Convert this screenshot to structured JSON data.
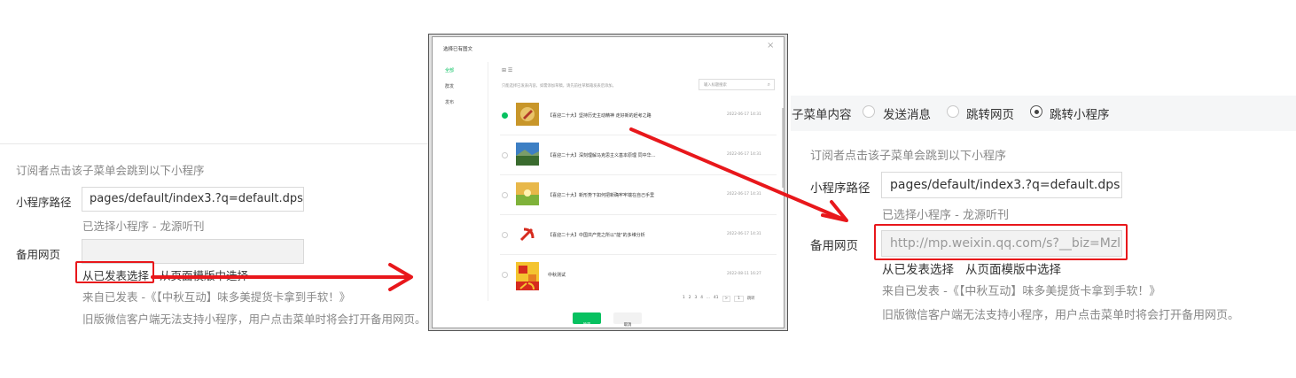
{
  "left_panel": {
    "description": "订阅者点击该子菜单会跳到以下小程序",
    "path_label": "小程序路径",
    "path_value": "pages/default/index3.?q=default.dps.q",
    "selected_miniprogram": "已选择小程序 - 龙源听刊",
    "backup_label": "备用网页",
    "backup_value": "",
    "link_published": "从已发表选择",
    "link_template": "从页面模版中选择",
    "source_text": "来自已发表 -《【中秋互动】味多美提货卡拿到手软！》",
    "note": "旧版微信客户端无法支持小程序，用户点击菜单时将会打开备用网页。"
  },
  "modal": {
    "title": "选择已有图文",
    "close_icon": "close-icon",
    "side_tabs": [
      "全部",
      "群发",
      "发布"
    ],
    "view_icons": "grid-list-icons",
    "hint": "只能选择已发表内容，如需添加草稿，请先前往草稿箱发表后添加。",
    "search_placeholder": "输入标题搜索",
    "items": [
      {
        "title": "【喜迎二十大】坚持历史主动精神 走好新的赶考之路",
        "date": "2022-06-17 14:31",
        "selected": true
      },
      {
        "title": "【喜迎二十大】深刻理解马克思主义基本原理 同中华…",
        "date": "2022-06-17 14:31",
        "selected": false
      },
      {
        "title": "【喜迎二十大】新形势下如何把新确牢牢端在自己手里",
        "date": "2022-06-17 14:31",
        "selected": false
      },
      {
        "title": "【喜迎二十大】中国共产党之所以\"能\"的多维分析",
        "date": "2022-06-17 14:31",
        "selected": false
      },
      {
        "title": "中秋测试",
        "date": "2022-08-11 16:27",
        "selected": false
      }
    ],
    "pagination": [
      "1",
      "2",
      "3",
      "4",
      "...",
      "41",
      ">",
      "1",
      "跳转"
    ],
    "confirm_label": "确定",
    "cancel_label": "取消"
  },
  "right_panel": {
    "menu_content_label": "子菜单内容",
    "options": [
      "发送消息",
      "跳转网页",
      "跳转小程序"
    ],
    "selected_option": "跳转小程序",
    "description": "订阅者点击该子菜单会跳到以下小程序",
    "path_label": "小程序路径",
    "path_value": "pages/default/index3.?q=default.dps.q",
    "selected_miniprogram": "已选择小程序 - 龙源听刊",
    "backup_label": "备用网页",
    "backup_value": "http://mp.weixin.qq.com/s?__biz=Mzl1",
    "link_published": "从已发表选择",
    "link_template": "从页面模版中选择",
    "source_text": "来自已发表 -《【中秋互动】味多美提货卡拿到手软！》",
    "note": "旧版微信客户端无法支持小程序，用户点击菜单时将会打开备用网页。"
  },
  "colors": {
    "annotation_red": "#e8171b",
    "wechat_green": "#07c160"
  }
}
